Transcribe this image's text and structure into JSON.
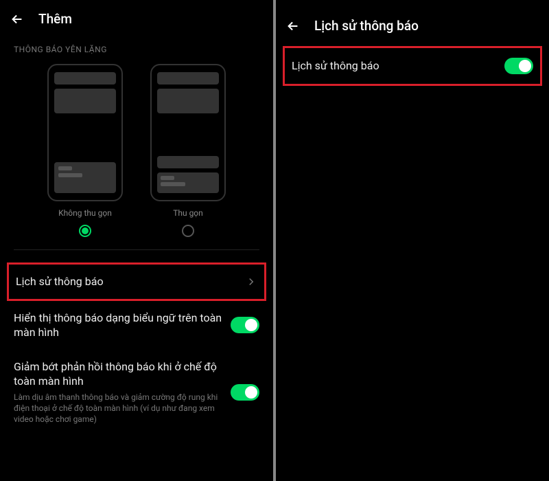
{
  "left": {
    "header_title": "Thêm",
    "section_label": "THÔNG BÁO YÊN LẶNG",
    "preview_a_label": "Không thu gọn",
    "preview_b_label": "Thu gọn",
    "selected_preview": "a",
    "item_history": "Lịch sử thông báo",
    "item_banner": "Hiển thị thông báo dạng biểu ngữ trên toàn màn hình",
    "item_reduce_title": "Giảm bớt phản hồi thông báo khi ở chế độ toàn màn hình",
    "item_reduce_sub": "Làm dịu âm thanh thông báo và giảm cường độ rung khi điện thoại ở chế độ toàn màn hình (ví dụ như đang xem video hoặc chơi game)"
  },
  "right": {
    "header_title": "Lịch sử thông báo",
    "toggle_label": "Lịch sử thông báo"
  }
}
